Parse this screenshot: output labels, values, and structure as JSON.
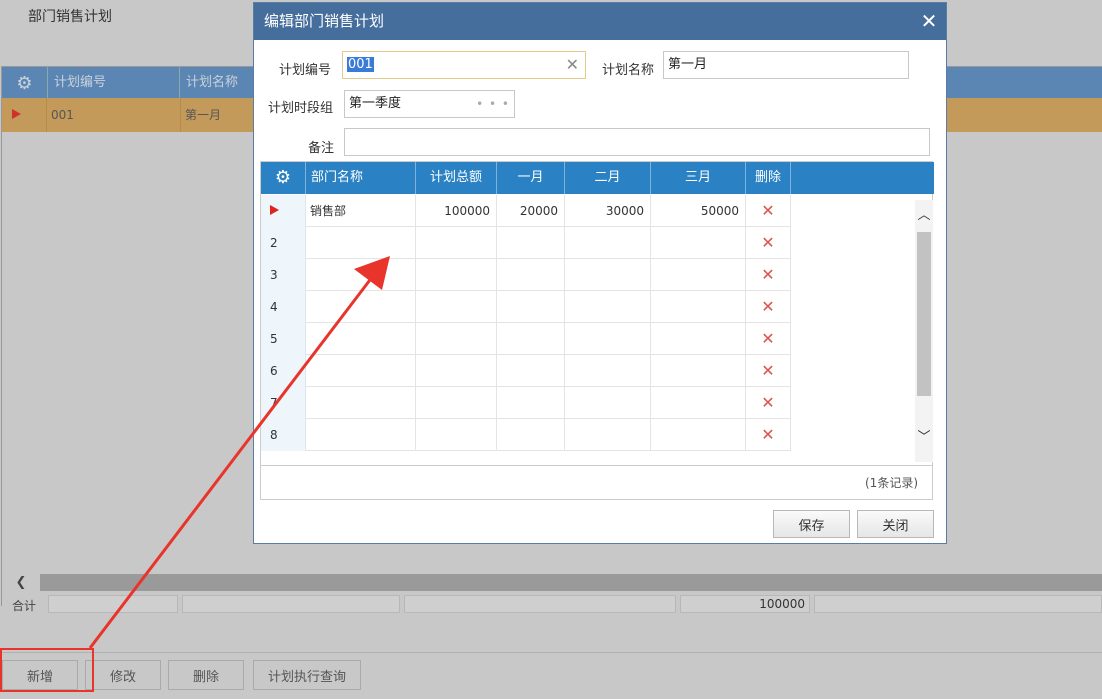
{
  "page": {
    "title": "部门销售计划",
    "grid_headers": [
      "计划编号",
      "计划名称"
    ],
    "row": {
      "plan_no": "001",
      "plan_name": "第一月"
    },
    "total_label": "合计",
    "total_value": "100000",
    "buttons": {
      "add": "新增",
      "edit": "修改",
      "delete": "删除",
      "query": "计划执行查询"
    }
  },
  "dialog": {
    "title": "编辑部门销售计划",
    "close_glyph": "✕",
    "fields": {
      "plan_no_label": "计划编号",
      "plan_no_value": "001",
      "plan_name_label": "计划名称",
      "plan_name_value": "第一月",
      "period_group_label": "计划时段组",
      "period_group_value": "第一季度",
      "remark_label": "备注",
      "remark_value": ""
    },
    "grid": {
      "headers": [
        "部门名称",
        "计划总额",
        "一月",
        "二月",
        "三月",
        "删除"
      ],
      "rows": [
        {
          "no": "",
          "dept": "销售部",
          "total": "100000",
          "m1": "20000",
          "m2": "30000",
          "m3": "50000"
        },
        {
          "no": "2",
          "dept": "",
          "total": "",
          "m1": "",
          "m2": "",
          "m3": ""
        },
        {
          "no": "3",
          "dept": "",
          "total": "",
          "m1": "",
          "m2": "",
          "m3": ""
        },
        {
          "no": "4",
          "dept": "",
          "total": "",
          "m1": "",
          "m2": "",
          "m3": ""
        },
        {
          "no": "5",
          "dept": "",
          "total": "",
          "m1": "",
          "m2": "",
          "m3": ""
        },
        {
          "no": "6",
          "dept": "",
          "total": "",
          "m1": "",
          "m2": "",
          "m3": ""
        },
        {
          "no": "7",
          "dept": "",
          "total": "",
          "m1": "",
          "m2": "",
          "m3": ""
        },
        {
          "no": "8",
          "dept": "",
          "total": "",
          "m1": "",
          "m2": "",
          "m3": ""
        }
      ],
      "delete_glyph": "✕",
      "record_count": "(1条记录)"
    },
    "buttons": {
      "save": "保存",
      "close": "关闭"
    }
  },
  "colors": {
    "dialog_header": "#456e9c",
    "grid_header": "#2a81c4",
    "selected_row": "#c49a5a",
    "annotation": "#e8342a"
  }
}
